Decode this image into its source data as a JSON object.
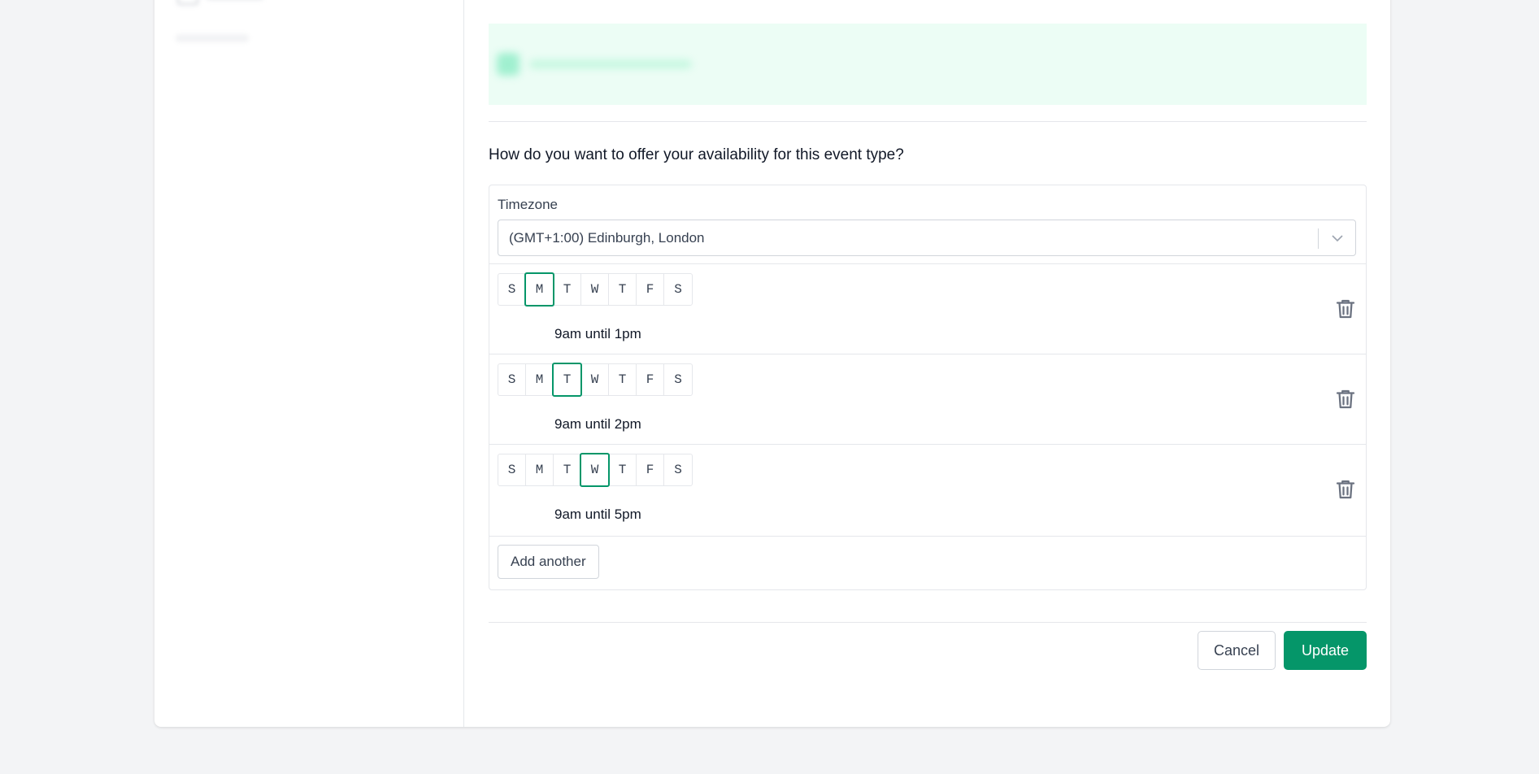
{
  "colors": {
    "accent": "#059669",
    "banner": "#ecfdf5"
  },
  "availability": {
    "question": "How do you want to offer your availability for this event type?",
    "timezone_label": "Timezone",
    "timezone_value": "(GMT+1:00) Edinburgh, London",
    "day_letters": [
      "S",
      "M",
      "T",
      "W",
      "T",
      "F",
      "S"
    ],
    "rows": [
      {
        "selected_day_index": 1,
        "time": "9am until 1pm"
      },
      {
        "selected_day_index": 2,
        "time": "9am until 2pm"
      },
      {
        "selected_day_index": 3,
        "time": "9am until 5pm"
      }
    ],
    "add_label": "Add another"
  },
  "icons": {
    "delete": "trash-icon",
    "dropdown": "chevron-down-icon"
  },
  "actions": {
    "cancel_label": "Cancel",
    "update_label": "Update"
  }
}
